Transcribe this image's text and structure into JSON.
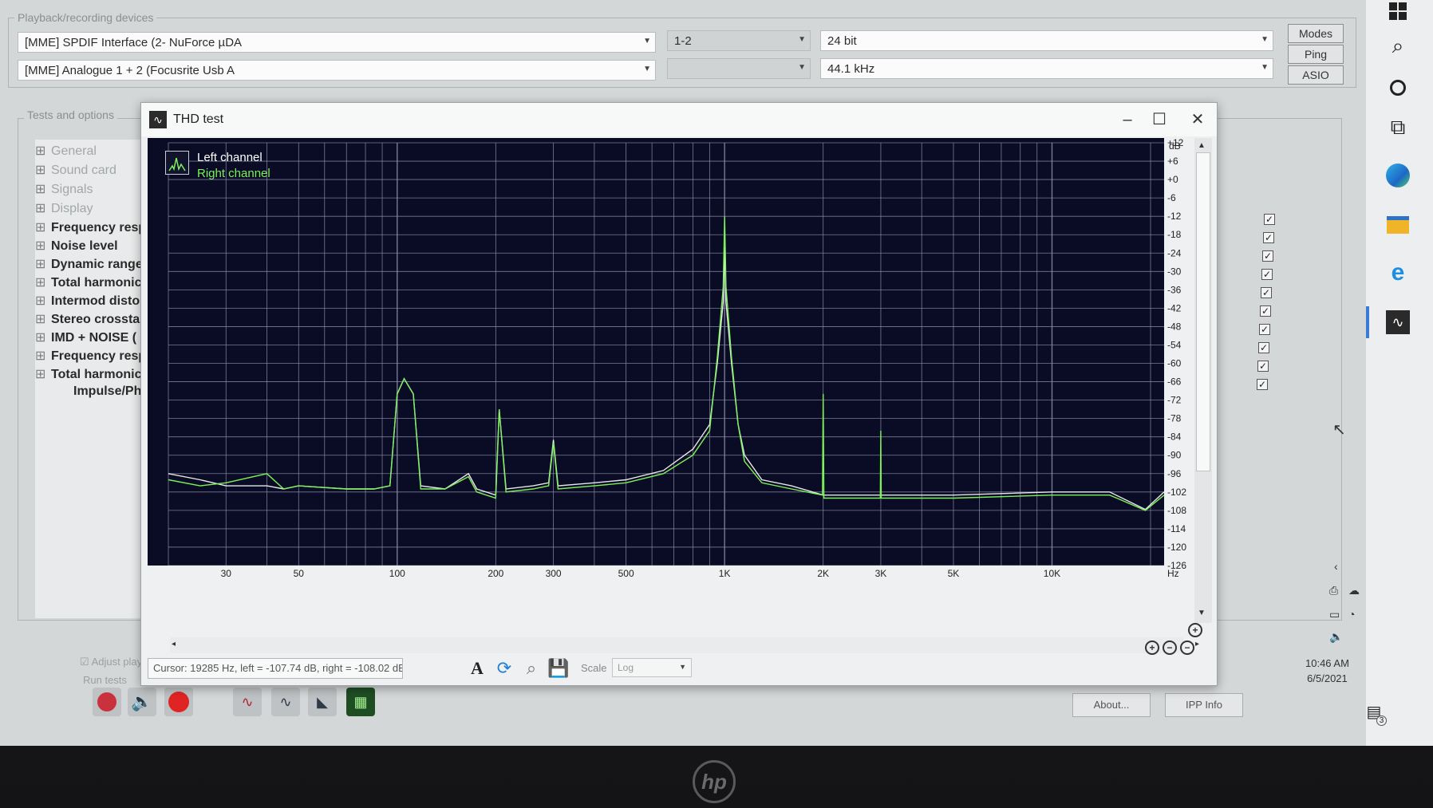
{
  "devices": {
    "group_title": "Playback/recording devices",
    "playback_device": "[MME] SPDIF Interface (2- NuForce µDA",
    "recording_device": "[MME] Analogue 1 + 2 (Focusrite Usb A",
    "channels": "1-2",
    "bit_depth": "24 bit",
    "sample_rate": "44.1 kHz",
    "buttons": [
      "Modes",
      "Ping",
      "ASIO"
    ]
  },
  "tests": {
    "group_title": "Tests and options",
    "items": [
      {
        "label": "General",
        "dim": true
      },
      {
        "label": "Sound card",
        "dim": true
      },
      {
        "label": "Signals",
        "dim": true
      },
      {
        "label": "Display",
        "dim": true
      },
      {
        "label": "Frequency resp",
        "dim": false
      },
      {
        "label": "Noise level",
        "dim": false
      },
      {
        "label": "Dynamic range",
        "dim": false
      },
      {
        "label": "Total harmonic",
        "dim": false
      },
      {
        "label": "Intermod disto",
        "dim": false
      },
      {
        "label": "Stereo crossta",
        "dim": false
      },
      {
        "label": "IMD + NOISE (",
        "dim": false
      },
      {
        "label": "Frequency resp",
        "dim": false
      },
      {
        "label": "Total harmonic",
        "dim": false
      },
      {
        "label": "Impulse/Phase",
        "dim": false
      }
    ],
    "adjust_label": "Adjust playback/reco",
    "run_tests_label": "Run tests"
  },
  "bottom_buttons": [
    "About...",
    "IPP Info"
  ],
  "thd_window": {
    "title": "THD test",
    "legend": {
      "left": "Left channel",
      "right": "Right channel"
    },
    "cursor_text": "Cursor:  19285 Hz,  left = -107.74 dB,  right = -108.02 dB",
    "scale_label": "Scale",
    "scale_value": "Log",
    "colors": {
      "left": "#ffffff",
      "right": "#7cf25a",
      "bg": "#0a0b24",
      "grid": "#8a8fa8"
    }
  },
  "chart_data": {
    "type": "line",
    "title": "",
    "xlabel": "Hz",
    "ylabel": "dB",
    "x_scale": "log",
    "xlim": [
      20,
      22000
    ],
    "ylim": [
      -126,
      12
    ],
    "x_tick_labels": [
      "30",
      "50",
      "100",
      "200",
      "300",
      "500",
      "1K",
      "2K",
      "3K",
      "5K",
      "10K"
    ],
    "x_tick_values": [
      30,
      50,
      100,
      200,
      300,
      500,
      1000,
      2000,
      3000,
      5000,
      10000
    ],
    "y_tick_labels": [
      "+12",
      "+6",
      "+0",
      "-6",
      "-12",
      "-18",
      "-24",
      "-30",
      "-36",
      "-42",
      "-48",
      "-54",
      "-60",
      "-66",
      "-72",
      "-78",
      "-84",
      "-90",
      "-96",
      "-102",
      "-108",
      "-114",
      "-120",
      "-126"
    ],
    "y_tick_values": [
      12,
      6,
      0,
      -6,
      -12,
      -18,
      -24,
      -30,
      -36,
      -42,
      -48,
      -54,
      -60,
      -66,
      -72,
      -78,
      -84,
      -90,
      -96,
      -102,
      -108,
      -114,
      -120,
      -126
    ],
    "grid": true,
    "legend_position": "top-left",
    "series": [
      {
        "name": "Left channel",
        "points": [
          [
            20,
            -96
          ],
          [
            25,
            -98
          ],
          [
            30,
            -100
          ],
          [
            40,
            -100
          ],
          [
            45,
            -101
          ],
          [
            50,
            -100
          ],
          [
            70,
            -101
          ],
          [
            85,
            -101
          ],
          [
            95,
            -100
          ],
          [
            100,
            -70
          ],
          [
            105,
            -65
          ],
          [
            112,
            -70
          ],
          [
            118,
            -100
          ],
          [
            140,
            -101
          ],
          [
            165,
            -96
          ],
          [
            175,
            -101
          ],
          [
            200,
            -103
          ],
          [
            205,
            -75
          ],
          [
            215,
            -101
          ],
          [
            260,
            -100
          ],
          [
            290,
            -99
          ],
          [
            300,
            -85
          ],
          [
            310,
            -100
          ],
          [
            400,
            -99
          ],
          [
            500,
            -98
          ],
          [
            650,
            -95
          ],
          [
            800,
            -88
          ],
          [
            900,
            -80
          ],
          [
            950,
            -60
          ],
          [
            990,
            -40
          ],
          [
            1000,
            -22
          ],
          [
            1010,
            -40
          ],
          [
            1050,
            -60
          ],
          [
            1100,
            -80
          ],
          [
            1150,
            -90
          ],
          [
            1300,
            -98
          ],
          [
            1600,
            -100
          ],
          [
            2000,
            -103
          ],
          [
            5000,
            -103
          ],
          [
            10000,
            -102
          ],
          [
            15000,
            -102
          ],
          [
            19285,
            -107.7
          ],
          [
            22000,
            -102
          ]
        ]
      },
      {
        "name": "Right channel",
        "points": [
          [
            20,
            -98
          ],
          [
            25,
            -100
          ],
          [
            30,
            -99
          ],
          [
            40,
            -96
          ],
          [
            45,
            -101
          ],
          [
            50,
            -100
          ],
          [
            70,
            -101
          ],
          [
            85,
            -101
          ],
          [
            95,
            -100
          ],
          [
            100,
            -70
          ],
          [
            105,
            -65
          ],
          [
            112,
            -70
          ],
          [
            118,
            -101
          ],
          [
            140,
            -101
          ],
          [
            165,
            -97
          ],
          [
            175,
            -102
          ],
          [
            200,
            -104
          ],
          [
            205,
            -75
          ],
          [
            215,
            -102
          ],
          [
            260,
            -101
          ],
          [
            290,
            -100
          ],
          [
            300,
            -86
          ],
          [
            310,
            -101
          ],
          [
            400,
            -100
          ],
          [
            500,
            -99
          ],
          [
            650,
            -96
          ],
          [
            800,
            -90
          ],
          [
            900,
            -82
          ],
          [
            950,
            -58
          ],
          [
            990,
            -35
          ],
          [
            1000,
            -12
          ],
          [
            1010,
            -35
          ],
          [
            1050,
            -58
          ],
          [
            1100,
            -80
          ],
          [
            1150,
            -92
          ],
          [
            1300,
            -99
          ],
          [
            1600,
            -101
          ],
          [
            1990,
            -103
          ],
          [
            2000,
            -70
          ],
          [
            2010,
            -104
          ],
          [
            2990,
            -104
          ],
          [
            3000,
            -82
          ],
          [
            3010,
            -104
          ],
          [
            5000,
            -104
          ],
          [
            10000,
            -103
          ],
          [
            15000,
            -103
          ],
          [
            19285,
            -108.0
          ],
          [
            22000,
            -103
          ]
        ]
      }
    ]
  },
  "system": {
    "time": "10:46 AM",
    "date": "6/5/2021",
    "notification_count": "3"
  }
}
